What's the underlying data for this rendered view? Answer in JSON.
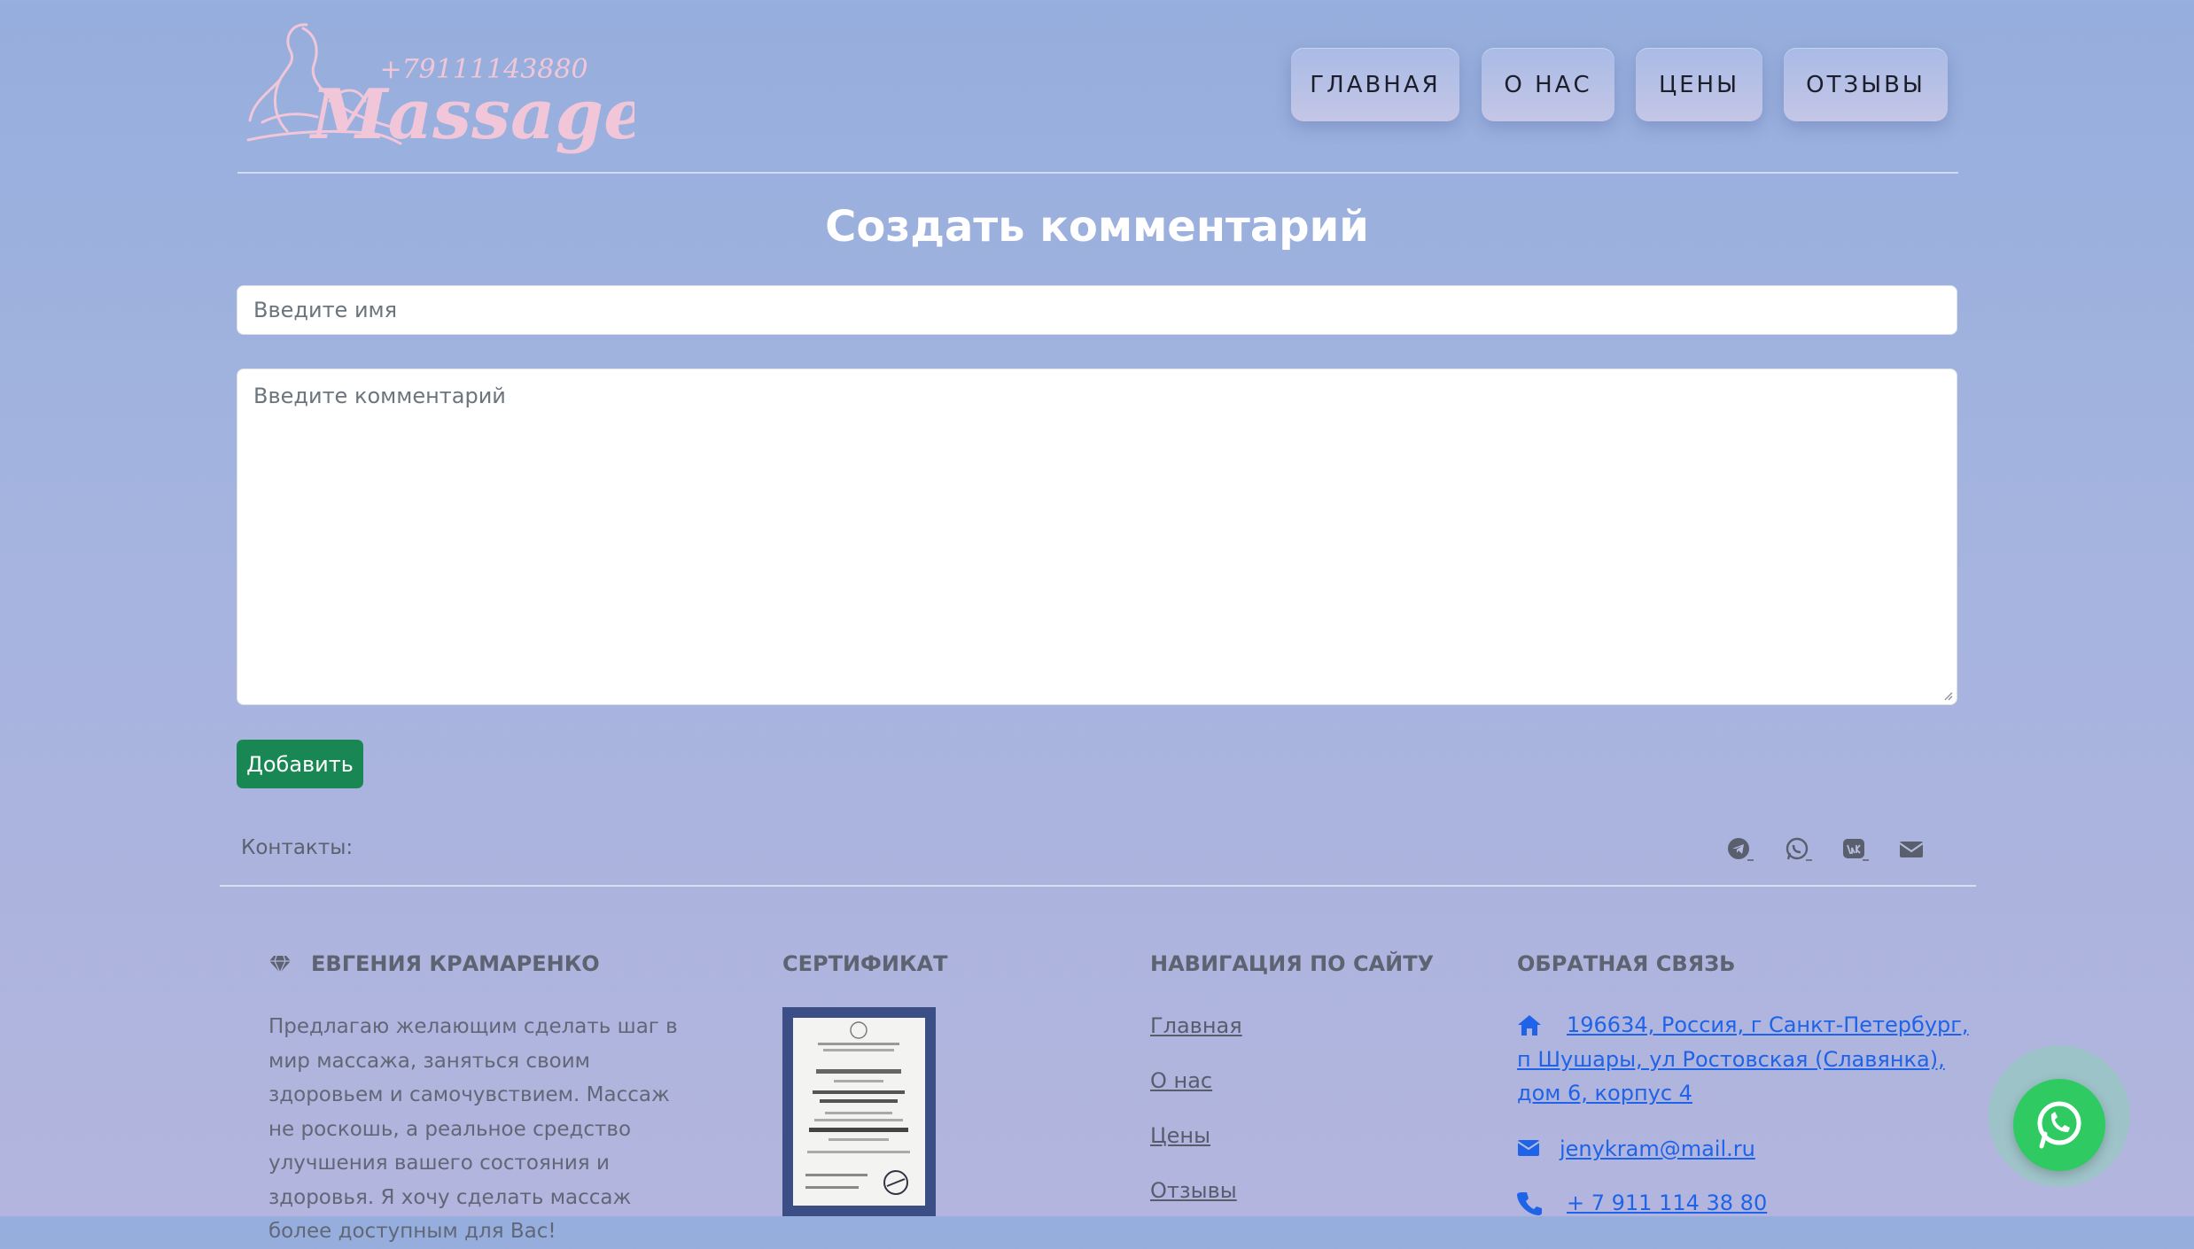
{
  "brand": {
    "phone": "+79111143880",
    "name": "Massage"
  },
  "nav": {
    "items": [
      {
        "label": "ГЛАВНАЯ"
      },
      {
        "label": "О НАС"
      },
      {
        "label": "ЦЕНЫ"
      },
      {
        "label": "ОТЗЫВЫ"
      }
    ]
  },
  "form": {
    "title": "Создать комментарий",
    "name_placeholder": "Введите имя",
    "comment_placeholder": "Введите комментарий",
    "submit_label": "Добавить"
  },
  "contacts": {
    "label": "Контакты:",
    "icons": [
      "telegram-icon",
      "whatsapp-icon",
      "vk-icon",
      "envelope-icon"
    ]
  },
  "footer": {
    "about": {
      "heading": "ЕВГЕНИЯ КРАМАРЕНКО",
      "text": "Предлагаю желающим сделать шаг в мир массажа, заняться своим здоровьем и самочувствием. Массаж не роскошь, а реальное средство улучшения вашего состояния и здоровья. Я хочу сделать массаж более доступным для Вас!"
    },
    "certificate": {
      "heading": "СЕРТИФИКАТ"
    },
    "navigation": {
      "heading": "НАВИГАЦИЯ ПО САЙТУ",
      "links": [
        "Главная",
        "О нас",
        "Цены",
        "Отзывы"
      ]
    },
    "feedback": {
      "heading": "ОБРАТНАЯ СВЯЗЬ",
      "address_lines": [
        "196634, Россия, г Санкт-Петербург,",
        "п Шушары, ул Ростовская (Славянка),",
        "дом 6, корпус 4"
      ],
      "email": "jenykram@mail.ru",
      "phone": "+ 7 911 114 38 80"
    }
  },
  "colors": {
    "accent_green": "#198754",
    "link_blue": "#1e63e8",
    "logo_pink": "#f0c6d8",
    "whatsapp": "#2fcb62"
  }
}
